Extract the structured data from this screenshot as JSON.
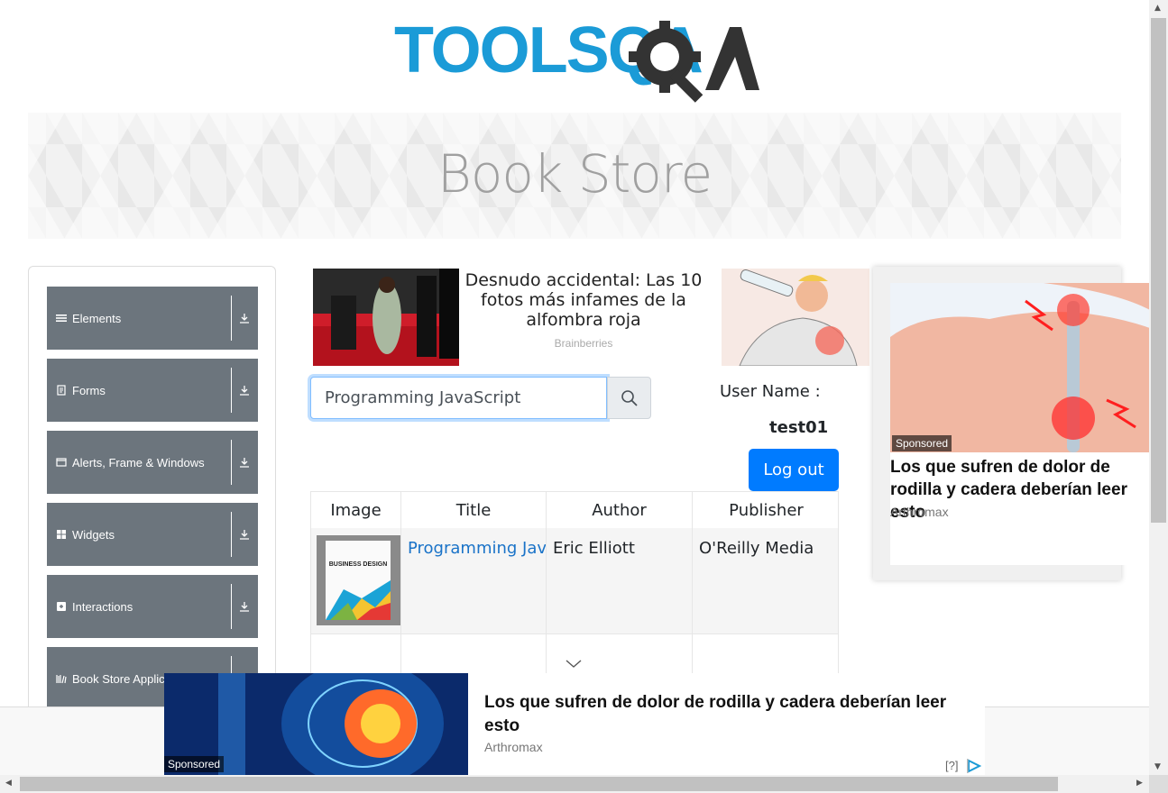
{
  "header": {
    "logo_text": "TOOLSQA",
    "banner_title": "Book Store"
  },
  "sidebar": {
    "items": [
      {
        "label": "Elements",
        "icon": "list-icon"
      },
      {
        "label": "Forms",
        "icon": "form-icon"
      },
      {
        "label": "Alerts, Frame & Windows",
        "icon": "window-icon"
      },
      {
        "label": "Widgets",
        "icon": "widgets-icon"
      },
      {
        "label": "Interactions",
        "icon": "interactions-icon"
      },
      {
        "label": "Book Store Applica",
        "icon": "books-icon"
      }
    ]
  },
  "ads": {
    "top": {
      "headline": "Desnudo accidental: Las 10 fotos más infames de la alfombra roja",
      "source": "Brainberries"
    },
    "right": {
      "badge": "Sponsored",
      "headline": "Los que sufren de dolor de rodilla y cadera deberían leer esto",
      "source": "Arthromax"
    },
    "bottom": {
      "badge": "Sponsored",
      "headline": "Los que sufren de dolor de rodilla y cadera deberían leer esto",
      "source": "Arthromax",
      "info": "[?]"
    }
  },
  "search": {
    "value": "Programming JavaScript"
  },
  "user": {
    "label": "User Name :",
    "value": "test01",
    "logout_label": "Log out"
  },
  "table": {
    "headers": [
      "Image",
      "Title",
      "Author",
      "Publisher"
    ],
    "rows": [
      {
        "cover_text": "BUSINESS DESIGN",
        "title": "Programming JavaScript Applications",
        "author": "Eric Elliott",
        "publisher": "O'Reilly Media"
      }
    ]
  },
  "colors": {
    "brand_blue": "#1b9bd7",
    "sidebar_gray": "#6c757d",
    "button_blue": "#007bff",
    "link_blue": "#1a73c8"
  }
}
